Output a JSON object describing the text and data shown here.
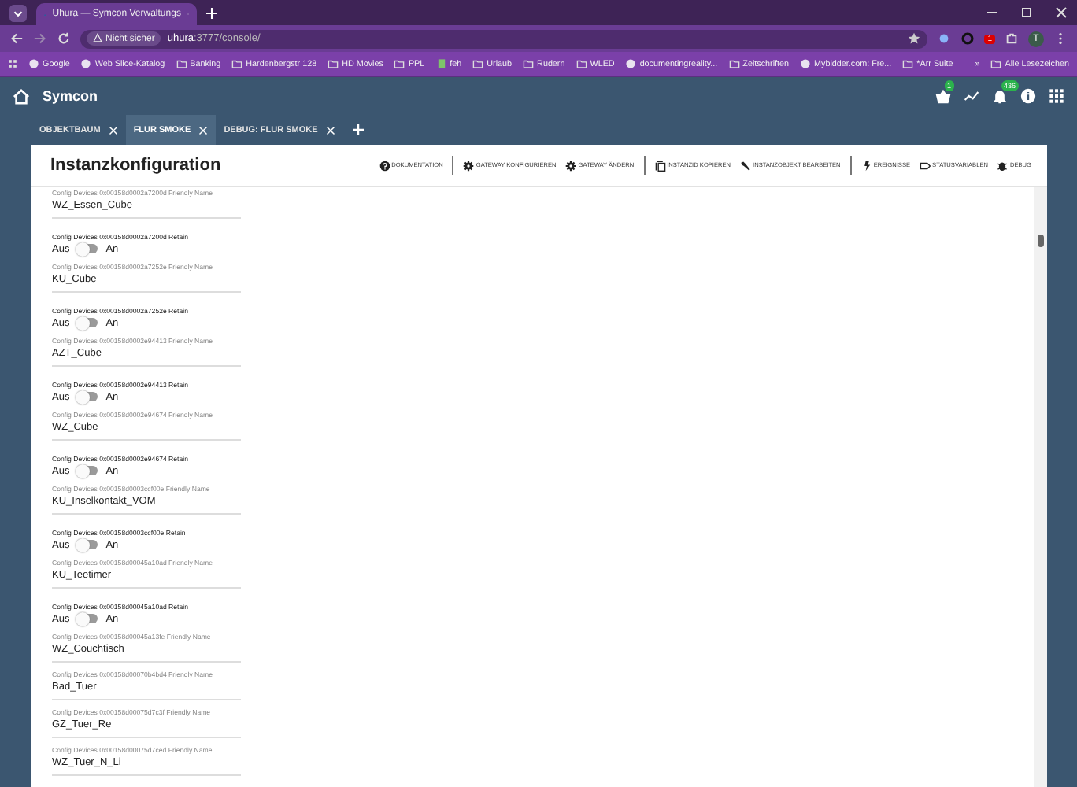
{
  "browser": {
    "tab_title": "Uhura — Symcon Verwaltungs",
    "security": "Nicht sicher",
    "url_host": "uhura",
    "url_rest": ":3777/console/",
    "profile": "T",
    "extension_badge": "1",
    "bookmarks": [
      {
        "label": "Google",
        "kind": "site"
      },
      {
        "label": "Web Slice-Katalog",
        "kind": "site"
      },
      {
        "label": "Banking",
        "kind": "folder"
      },
      {
        "label": "Hardenbergstr 128",
        "kind": "folder"
      },
      {
        "label": "HD Movies",
        "kind": "folder"
      },
      {
        "label": "PPL",
        "kind": "folder"
      },
      {
        "label": "feh",
        "kind": "page"
      },
      {
        "label": "Urlaub",
        "kind": "folder"
      },
      {
        "label": "Rudern",
        "kind": "folder"
      },
      {
        "label": "WLED",
        "kind": "folder"
      },
      {
        "label": "documentingreality...",
        "kind": "site"
      },
      {
        "label": "Zeitschriften",
        "kind": "folder"
      },
      {
        "label": "Mybidder.com: Fre...",
        "kind": "site"
      },
      {
        "label": "*Arr Suite",
        "kind": "folder"
      }
    ],
    "overflow": "»",
    "all_bookmarks": "Alle Lesezeichen"
  },
  "app": {
    "title": "Symcon",
    "basket_badge": "1",
    "bell_badge": "436"
  },
  "tabs": [
    {
      "label": "OBJEKTBAUM",
      "selected": false
    },
    {
      "label": "FLUR SMOKE",
      "selected": true
    },
    {
      "label": "DEBUG: FLUR SMOKE",
      "selected": false
    }
  ],
  "panel": {
    "title": "Instanzkonfiguration",
    "toolbar": [
      [
        {
          "label": "DOKUMENTATION",
          "kind": "help"
        }
      ],
      [
        {
          "label": "GATEWAY KONFIGURIEREN",
          "kind": "gateway"
        },
        {
          "label": "GATEWAY ÄNDERN",
          "kind": "gateway"
        }
      ],
      [
        {
          "label": "INSTANZID KOPIEREN",
          "kind": "copy"
        },
        {
          "label": "INSTANZOBJEKT BEARBEITEN",
          "kind": "edit"
        }
      ],
      [
        {
          "label": "EREIGNISSE",
          "kind": "events"
        },
        {
          "label": "STATUSVARIABLEN",
          "kind": "variables"
        },
        {
          "label": "DEBUG",
          "kind": "debug"
        }
      ]
    ],
    "fields": [
      {
        "kind": "text",
        "label": "Config Devices 0x00158d0002a7200d Friendly Name",
        "value": "WZ_Essen_Cube"
      },
      {
        "kind": "switch",
        "label": "Config Devices 0x00158d0002a7200d Retain",
        "off": "Aus",
        "on_label": "An",
        "on": false
      },
      {
        "kind": "text",
        "label": "Config Devices 0x00158d0002a7252e Friendly Name",
        "value": "KU_Cube"
      },
      {
        "kind": "switch",
        "label": "Config Devices 0x00158d0002a7252e Retain",
        "off": "Aus",
        "on_label": "An",
        "on": false
      },
      {
        "kind": "text",
        "label": "Config Devices 0x00158d0002e94413 Friendly Name",
        "value": "AZT_Cube"
      },
      {
        "kind": "switch",
        "label": "Config Devices 0x00158d0002e94413 Retain",
        "off": "Aus",
        "on_label": "An",
        "on": false
      },
      {
        "kind": "text",
        "label": "Config Devices 0x00158d0002e94674 Friendly Name",
        "value": "WZ_Cube"
      },
      {
        "kind": "switch",
        "label": "Config Devices 0x00158d0002e94674 Retain",
        "off": "Aus",
        "on_label": "An",
        "on": false
      },
      {
        "kind": "text",
        "label": "Config Devices 0x00158d0003ccf00e Friendly Name",
        "value": "KU_Inselkontakt_VOM"
      },
      {
        "kind": "switch",
        "label": "Config Devices 0x00158d0003ccf00e Retain",
        "off": "Aus",
        "on_label": "An",
        "on": false
      },
      {
        "kind": "text",
        "label": "Config Devices 0x00158d00045a10ad Friendly Name",
        "value": "KU_Teetimer"
      },
      {
        "kind": "switch",
        "label": "Config Devices 0x00158d00045a10ad Retain",
        "off": "Aus",
        "on_label": "An",
        "on": false
      },
      {
        "kind": "text",
        "label": "Config Devices 0x00158d00045a13fe Friendly Name",
        "value": "WZ_Couchtisch"
      },
      {
        "kind": "text",
        "label": "Config Devices 0x00158d00070b4bd4 Friendly Name",
        "value": "Bad_Tuer"
      },
      {
        "kind": "text",
        "label": "Config Devices 0x00158d00075d7c3f Friendly Name",
        "value": "GZ_Tuer_Re"
      },
      {
        "kind": "text",
        "label": "Config Devices 0x00158d00075d7ced Friendly Name",
        "value": "WZ_Tuer_N_Li"
      }
    ]
  }
}
